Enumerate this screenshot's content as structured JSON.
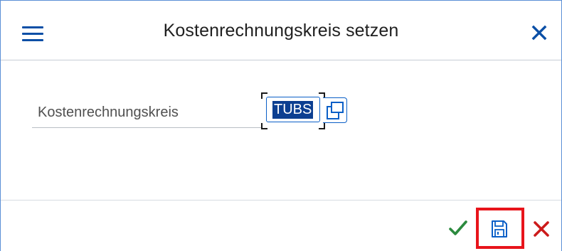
{
  "dialog": {
    "title": "Kostenrechnungskreis setzen",
    "menu_icon": "hamburger-menu-icon",
    "close_icon": "close-icon"
  },
  "form": {
    "field_label": "Kostenrechnungskreis",
    "field_value": "TUBS",
    "value_help_icon": "value-help-icon"
  },
  "footer": {
    "ok_icon": "checkmark-icon",
    "save_icon": "save-icon",
    "cancel_icon": "cancel-icon"
  },
  "colors": {
    "accent": "#0a4fa6",
    "ok": "#2b8a3e",
    "cancel": "#cc1b1b",
    "highlight_frame": "#e8141b",
    "selection": "#0c3f91"
  }
}
